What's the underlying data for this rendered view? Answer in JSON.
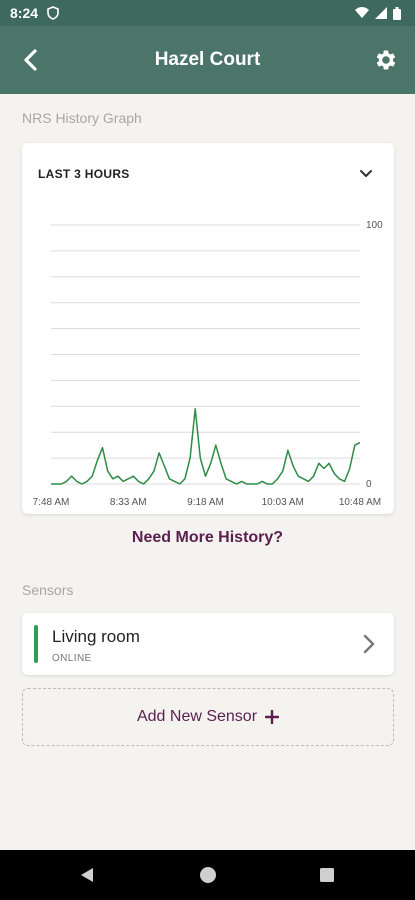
{
  "status_bar": {
    "time": "8:24"
  },
  "header": {
    "title": "Hazel Court"
  },
  "history": {
    "section_label": "NRS History Graph",
    "range_label": "LAST 3 HOURS",
    "more_link": "Need More History?"
  },
  "chart_data": {
    "type": "line",
    "title": "",
    "xlabel": "",
    "ylabel": "",
    "ylim": [
      0,
      100
    ],
    "y_tick_labels": [
      "100",
      "0"
    ],
    "x_tick_labels": [
      "7:48 AM",
      "8:33 AM",
      "9:18 AM",
      "10:03 AM",
      "10:48 AM"
    ],
    "grid": true,
    "color": "#2e8b46",
    "series": [
      {
        "x": [
          0,
          3,
          6,
          9,
          12,
          15,
          18,
          21,
          24,
          27,
          30,
          33,
          36,
          39,
          42,
          45,
          48,
          51,
          54,
          57,
          60,
          63,
          66,
          69,
          72,
          75,
          78,
          81,
          84,
          87,
          90,
          93,
          96,
          99,
          102,
          105,
          108,
          111,
          114,
          117,
          120,
          123,
          126,
          129,
          132,
          135,
          138,
          141,
          144,
          147,
          150,
          153,
          156,
          159,
          162,
          165,
          168,
          171,
          174,
          177,
          180
        ],
        "values": [
          0,
          0,
          0,
          1,
          3,
          1,
          0,
          1,
          3,
          9,
          14,
          5,
          2,
          3,
          1,
          2,
          3,
          1,
          0,
          2,
          5,
          12,
          7,
          2,
          1,
          0,
          2,
          10,
          29,
          10,
          3,
          8,
          15,
          8,
          2,
          1,
          0,
          1,
          0,
          0,
          0,
          1,
          0,
          0,
          2,
          5,
          13,
          7,
          3,
          2,
          1,
          3,
          8,
          6,
          8,
          4,
          2,
          1,
          6,
          15,
          16
        ]
      }
    ]
  },
  "sensors": {
    "section_label": "Sensors",
    "items": [
      {
        "name": "Living room",
        "status": "ONLINE"
      }
    ],
    "add_label": "Add New Sensor"
  }
}
